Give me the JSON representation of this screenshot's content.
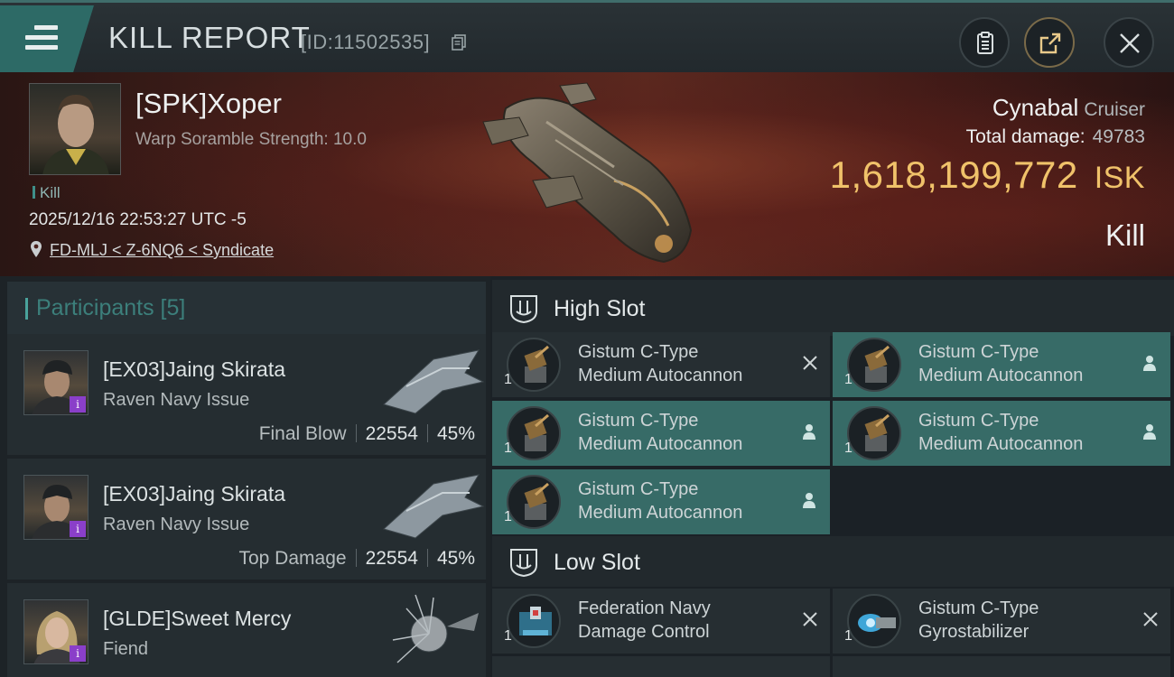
{
  "header": {
    "title": "KILL REPORT",
    "report_id": "[ID:11502535]"
  },
  "victim": {
    "name": "[SPK]Xoper",
    "detail": "Warp Soramble Strength: 10.0",
    "tag": "Kill",
    "datetime": "2025/12/16 22:53:27 UTC -5",
    "location": "FD-MLJ < Z-6NQ6 < Syndicate",
    "ship": "Cynabal",
    "ship_class": "Cruiser",
    "total_damage_label": "Total damage:",
    "total_damage": "49783",
    "value": "1,618,199,772",
    "value_unit": "ISK",
    "result": "Kill"
  },
  "participants": {
    "label": "Participants [5]",
    "rows": [
      {
        "name": "[EX03]Jaing Skirata",
        "ship": "Raven Navy Issue",
        "role": "Final Blow",
        "damage": "22554",
        "percent": "45%"
      },
      {
        "name": "[EX03]Jaing Skirata",
        "ship": "Raven Navy Issue",
        "role": "Top Damage",
        "damage": "22554",
        "percent": "45%"
      },
      {
        "name": "[GLDE]Sweet Mercy",
        "ship": "Fiend"
      }
    ]
  },
  "fitting": {
    "high_slot_label": "High Slot",
    "low_slot_label": "Low Slot",
    "high": [
      {
        "line1": "Gistum C-Type",
        "line2": "Medium Autocannon",
        "qty": "1",
        "state": "destroyed"
      },
      {
        "line1": "Gistum C-Type",
        "line2": "Medium Autocannon",
        "qty": "1",
        "state": "dropped"
      },
      {
        "line1": "Gistum C-Type",
        "line2": "Medium Autocannon",
        "qty": "1",
        "state": "dropped"
      },
      {
        "line1": "Gistum C-Type",
        "line2": "Medium Autocannon",
        "qty": "1",
        "state": "dropped"
      },
      {
        "line1": "Gistum C-Type",
        "line2": "Medium Autocannon",
        "qty": "1",
        "state": "dropped"
      }
    ],
    "low": [
      {
        "line1": "Federation Navy",
        "line2": "Damage Control",
        "qty": "1",
        "state": "destroyed"
      },
      {
        "line1": "Gistum C-Type",
        "line2": "Gyrostabilizer",
        "qty": "1",
        "state": "destroyed"
      }
    ]
  },
  "colors": {
    "accent_teal": "#376b67",
    "isk_gold": "#f0c26a",
    "badge_purple": "#8a3fc9"
  },
  "icons": [
    "menu-icon",
    "copy-icon",
    "clipboard-icon",
    "share-icon",
    "close-icon",
    "location-pin-icon",
    "slot-icon",
    "destroyed-x-icon",
    "dropped-person-icon"
  ]
}
